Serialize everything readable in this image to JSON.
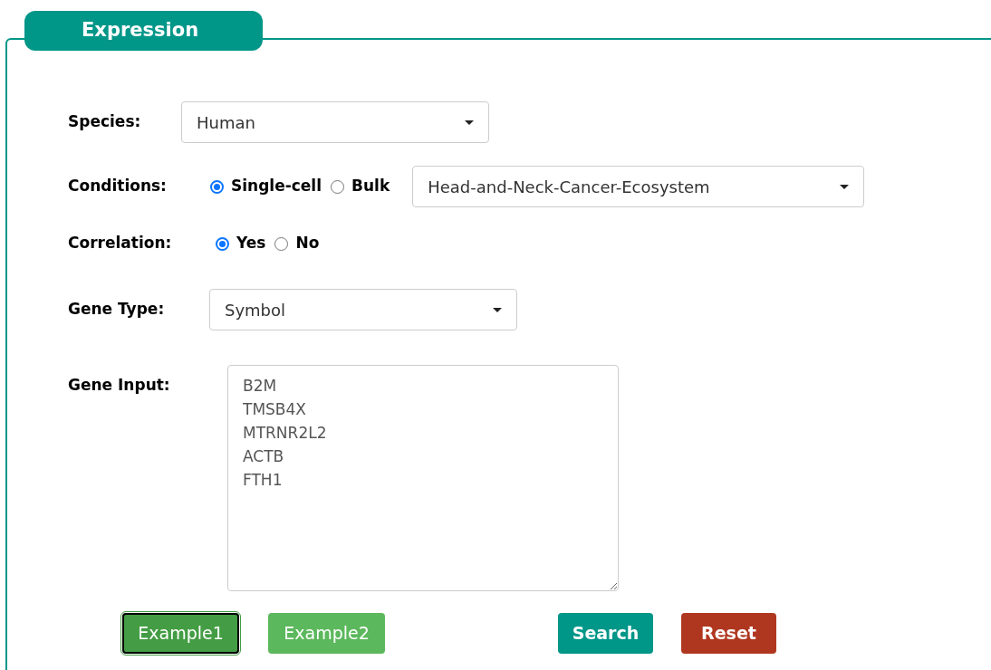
{
  "panel": {
    "title": "Expression"
  },
  "fields": [
    {
      "kind": "select",
      "label": "Species:",
      "value": "Human"
    },
    {
      "kind": "radio-select",
      "label": "Conditions:",
      "options": [
        {
          "label": "Single-cell",
          "selected": true
        },
        {
          "label": "Bulk",
          "selected": false
        }
      ],
      "value": "Head-and-Neck-Cancer-Ecosystem"
    },
    {
      "kind": "radio",
      "label": "Correlation:",
      "options": [
        {
          "label": "Yes",
          "selected": true
        },
        {
          "label": "No",
          "selected": false
        }
      ]
    },
    {
      "kind": "select",
      "label": "Gene Type:",
      "value": "Symbol"
    },
    {
      "kind": "textarea",
      "label": "Gene Input:",
      "lines": [
        "B2M",
        "TMSB4X",
        "MTRNR2L2",
        "ACTB",
        "FTH1"
      ]
    }
  ],
  "buttons": [
    {
      "kind": "example",
      "label": "Example1",
      "selected": true
    },
    {
      "kind": "example",
      "label": "Example2",
      "selected": false
    },
    {
      "kind": "search",
      "label": "Search"
    },
    {
      "kind": "reset",
      "label": "Reset"
    }
  ]
}
